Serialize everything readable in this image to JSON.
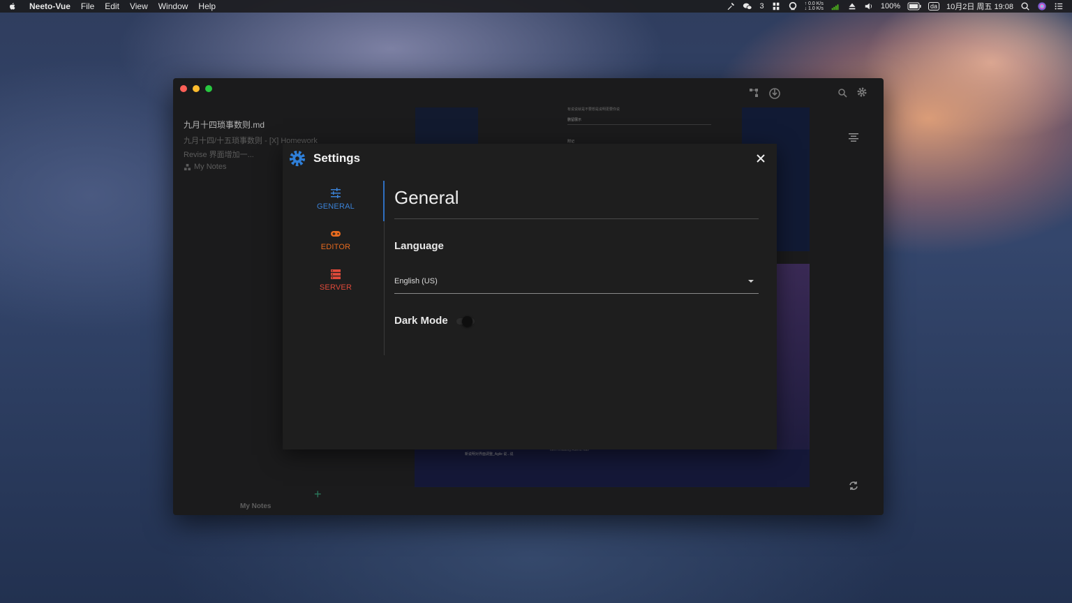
{
  "menubar": {
    "app_name": "Neeto-Vue",
    "items": [
      "File",
      "Edit",
      "View",
      "Window",
      "Help"
    ],
    "wechat_count": "3",
    "net_up": "↑ 0.0 K/s",
    "net_down": "↓ 1.0 K/s",
    "battery": "100%",
    "input_method": "da",
    "datetime": "10月2日 周五  19:08"
  },
  "window": {
    "note": {
      "title": "九月十四琐事数则.md",
      "subtitle": "九月十四/十五琐事数则 - [X] Homework",
      "excerpt": "Revise 界面增加一...",
      "folder": "My Notes"
    },
    "preview_texts": [
      "有说说就是不要想是说明更要你说",
      "删留展示",
      "附记"
    ],
    "preview_bottom_texts": [
      "新说明对界面调整_Agile 说...说",
      "Item Imitating Attend Nav"
    ],
    "bottom_label": "My Notes",
    "add_symbol": "+"
  },
  "settings": {
    "title": "Settings",
    "nav": {
      "general": "GENERAL",
      "editor": "EDITOR",
      "server": "SERVER"
    },
    "heading": "General",
    "language_label": "Language",
    "language_value": "English (US)",
    "dark_mode_label": "Dark Mode",
    "dark_mode_on": false
  },
  "colors": {
    "accent_general": "#3b82d6",
    "accent_editor": "#e76a1e",
    "accent_server": "#e04a3a",
    "add_button": "#2b7a5d"
  },
  "icons": {
    "settings": "gear-icon",
    "close": "close-icon",
    "general": "sliders-icon",
    "editor": "gamepad-icon",
    "server": "server-stack-icon",
    "language_dropdown": "caret-down-icon",
    "toolbar_left": [
      "diagram-icon",
      "sync-cloud-icon"
    ],
    "toolbar_right": [
      "search-icon",
      "gear-icon"
    ],
    "side": [
      "align-center-icon",
      "refresh-icon"
    ]
  }
}
